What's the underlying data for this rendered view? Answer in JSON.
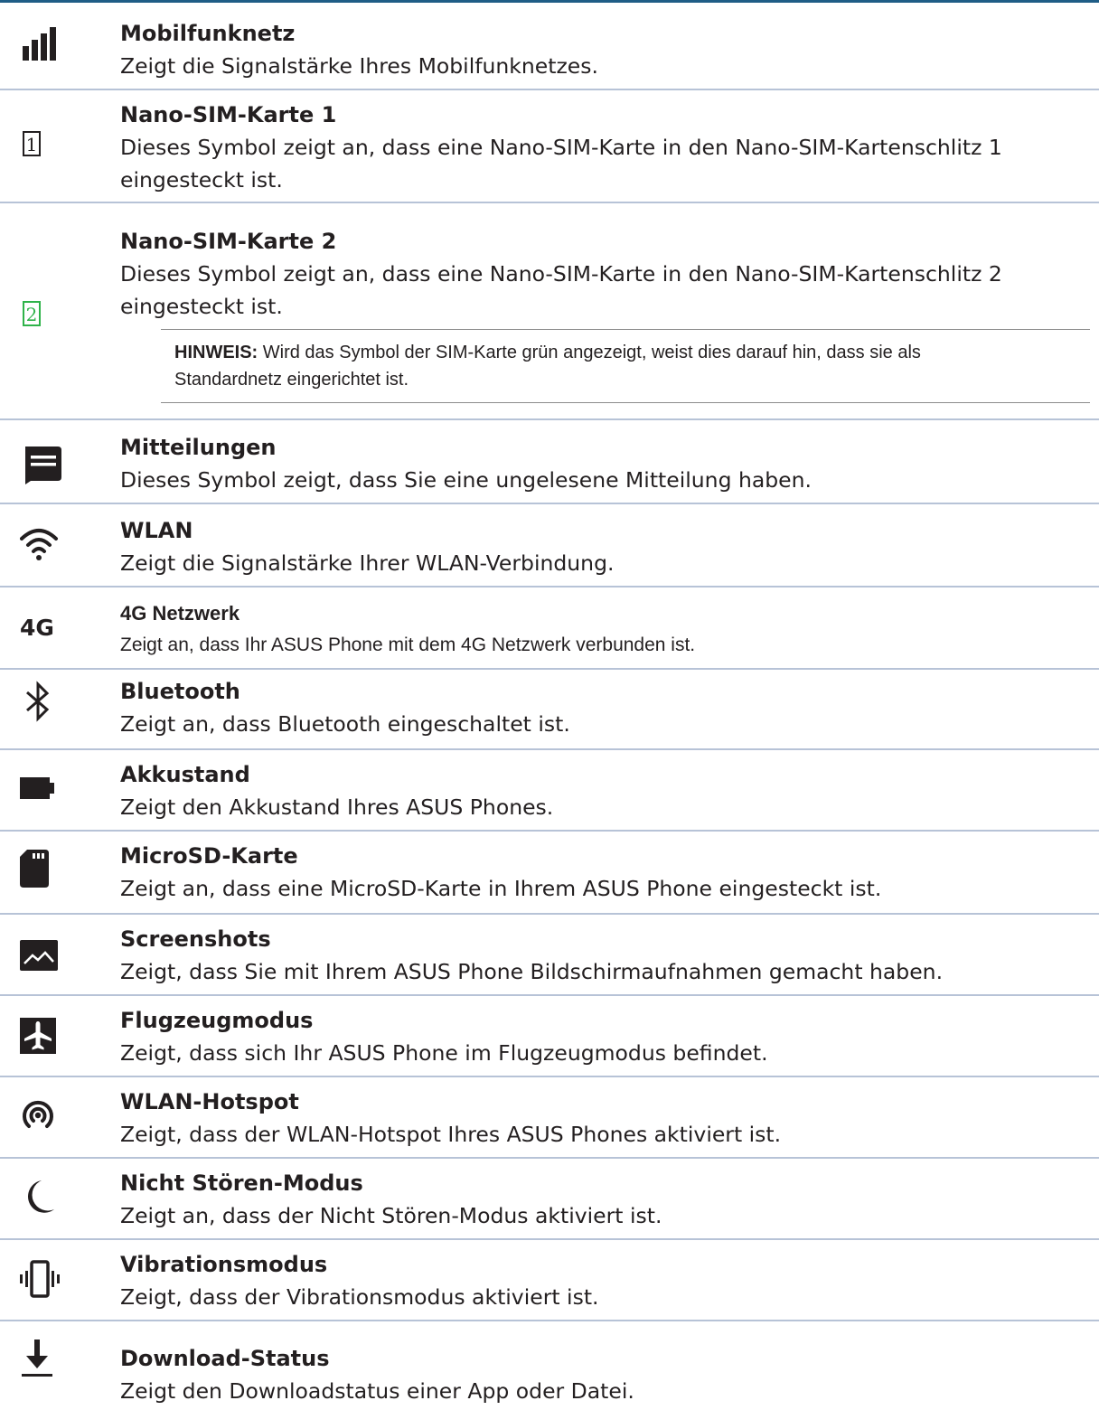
{
  "items": [
    {
      "title": "Mobilfunknetz",
      "desc": "Zeigt die Signalstärke Ihres Mobilfunknetzes.",
      "icon": "signal-bars-icon"
    },
    {
      "title": "Nano-SIM-Karte 1",
      "desc": "Dieses Symbol zeigt an, dass eine Nano-SIM-Karte in den Nano-SIM-Kartenschlitz 1",
      "desc2": "eingesteckt ist.",
      "icon": "sim-card-1-icon",
      "icon_text": "1"
    },
    {
      "title": "Nano-SIM-Karte 2",
      "desc": "Dieses Symbol zeigt an, dass eine Nano-SIM-Karte in den Nano-SIM-Kartenschlitz 2",
      "desc2": "eingesteckt ist.",
      "icon": "sim-card-2-icon",
      "icon_text": "2"
    },
    {
      "title": "Mitteilungen",
      "desc": "Dieses Symbol zeigt, dass Sie eine ungelesene Mitteilung haben.",
      "icon": "message-icon"
    },
    {
      "title": "WLAN",
      "desc": "Zeigt die Signalstärke Ihrer WLAN-Verbindung.",
      "icon": "wifi-icon"
    },
    {
      "title": "4G Netzwerk",
      "desc": "Zeigt an, dass Ihr ASUS Phone mit dem 4G Netzwerk verbunden ist.",
      "icon": "4g-icon",
      "icon_text": "4G"
    },
    {
      "title": "Bluetooth",
      "desc": "Zeigt an, dass Bluetooth eingeschaltet ist.",
      "icon": "bluetooth-icon"
    },
    {
      "title": "Akkustand",
      "desc": "Zeigt den Akkustand Ihres ASUS Phones.",
      "icon": "battery-icon"
    },
    {
      "title": "MicroSD-Karte",
      "desc": "Zeigt an, dass eine MicroSD-Karte in Ihrem ASUS Phone eingesteckt ist.",
      "icon": "microsd-card-icon"
    },
    {
      "title": "Screenshots",
      "desc": "Zeigt, dass Sie mit Ihrem ASUS Phone Bildschirmaufnahmen gemacht haben.",
      "icon": "screenshot-icon"
    },
    {
      "title": "Flugzeugmodus",
      "desc": "Zeigt, dass sich Ihr ASUS Phone im Flugzeugmodus befindet.",
      "icon": "airplane-icon"
    },
    {
      "title": "WLAN-Hotspot",
      "desc": "Zeigt, dass der WLAN-Hotspot Ihres ASUS Phones aktiviert ist.",
      "icon": "hotspot-icon"
    },
    {
      "title": "Nicht Stören-Modus",
      "desc": "Zeigt an, dass der Nicht Stören-Modus aktiviert ist.",
      "icon": "moon-icon"
    },
    {
      "title": "Vibrationsmodus",
      "desc": "Zeigt, dass der Vibrationsmodus aktiviert ist.",
      "icon": "vibrate-icon"
    },
    {
      "title": "Download-Status",
      "desc": "Zeigt den Downloadstatus einer App oder Datei.",
      "icon": "download-icon"
    }
  ],
  "note": {
    "label": "HINWEIS:",
    "text": " Wird das Symbol der SIM-Karte grün angezeigt, weist dies darauf hin, dass sie als",
    "text2": "Standardnetz eingerichtet ist."
  },
  "colors": {
    "text": "#231f20",
    "accent_green": "#2fb34a",
    "rule": "#b7c3d7",
    "top_rule": "#1f5d86"
  }
}
